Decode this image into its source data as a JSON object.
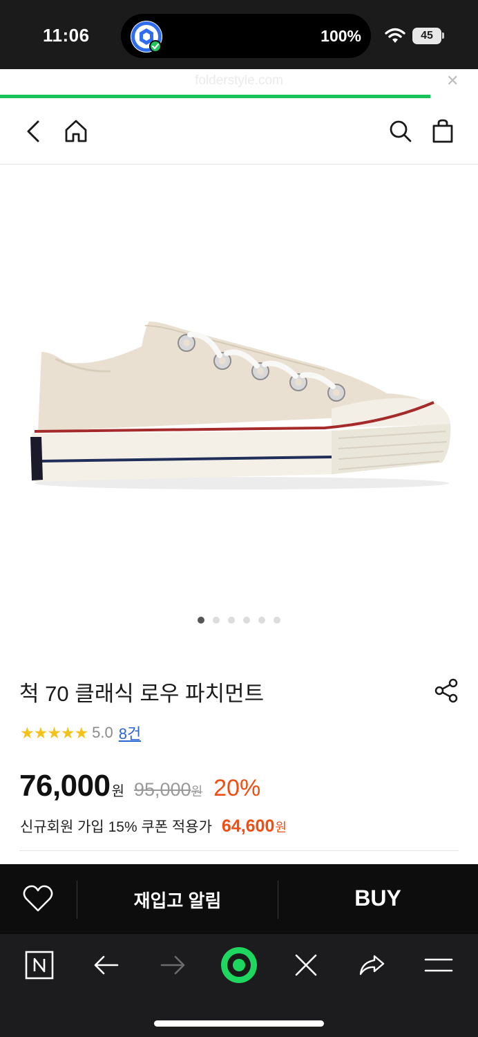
{
  "status_bar": {
    "time": "11:06",
    "island_battery": "100%",
    "battery_level": "45"
  },
  "browser": {
    "url": "folderstyle.com",
    "load_progress": 0.9,
    "accent_color": "#18c45a"
  },
  "product": {
    "title": "척 70 클래식 로우 파치먼트",
    "stars": "★★★★★",
    "rating": "5.0",
    "review_count": "8건",
    "price": "76,000",
    "price_unit": "원",
    "original_price": "95,000",
    "original_unit": "원",
    "discount": "20%",
    "coupon_text": "신규회원 가입 15% 쿠폰 적용가",
    "coupon_price": "64,600",
    "coupon_unit": "원",
    "image_count": 6,
    "active_image": 1
  },
  "actions": {
    "restock_label": "재입고 알림",
    "buy_label": "BUY"
  },
  "colors": {
    "discount": "#f04e12",
    "star": "#f5c21b",
    "link": "#2a64d6"
  }
}
